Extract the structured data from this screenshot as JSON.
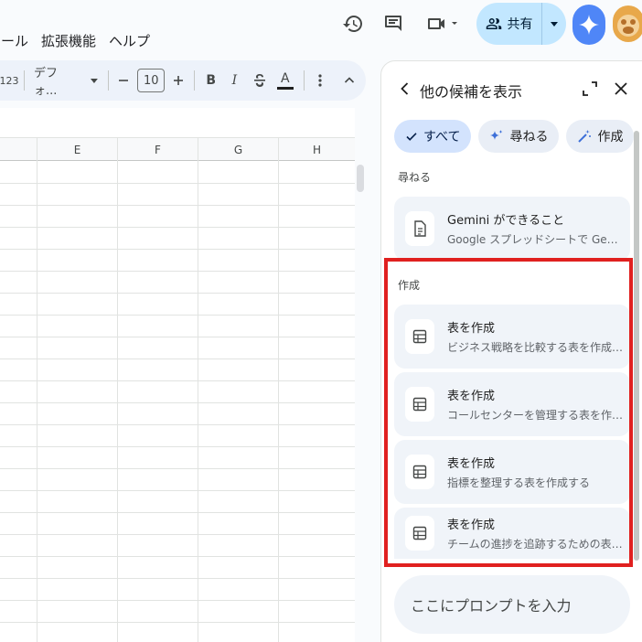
{
  "menus": [
    "ツール",
    "拡張機能",
    "ヘルプ"
  ],
  "share": {
    "label": "共有"
  },
  "toolbar": {
    "number_format": "123",
    "font": "デフォ...",
    "font_size": "10",
    "bold": "B",
    "italic": "I",
    "text_color": "A"
  },
  "grid": {
    "columns": [
      "E",
      "F",
      "G",
      "H"
    ]
  },
  "panel": {
    "title": "他の候補を表示",
    "chips": [
      {
        "label": "すべて",
        "icon": "check-icon",
        "active": true
      },
      {
        "label": "尋ねる",
        "icon": "sparkle-icon",
        "active": false
      },
      {
        "label": "作成",
        "icon": "magic-wand-icon",
        "active": false
      }
    ],
    "ask_section": "尋ねる",
    "ask_card": {
      "title": "Gemini ができること",
      "subtitle": "Google スプレッドシートで Gemini ..."
    },
    "create_section": "作成",
    "create_cards": [
      {
        "title": "表を作成",
        "subtitle": "ビジネス戦略を比較する表を作成する"
      },
      {
        "title": "表を作成",
        "subtitle": "コールセンターを管理する表を作成..."
      },
      {
        "title": "表を作成",
        "subtitle": "指標を整理する表を作成する"
      },
      {
        "title": "表を作成",
        "subtitle": "チームの進捗を追跡するための表を..."
      }
    ],
    "prompt_placeholder": "ここにプロンプトを入力"
  },
  "colors": {
    "highlight": "#e0201f",
    "share_bg": "#c2e7ff",
    "gemini": "#4f86f7"
  }
}
